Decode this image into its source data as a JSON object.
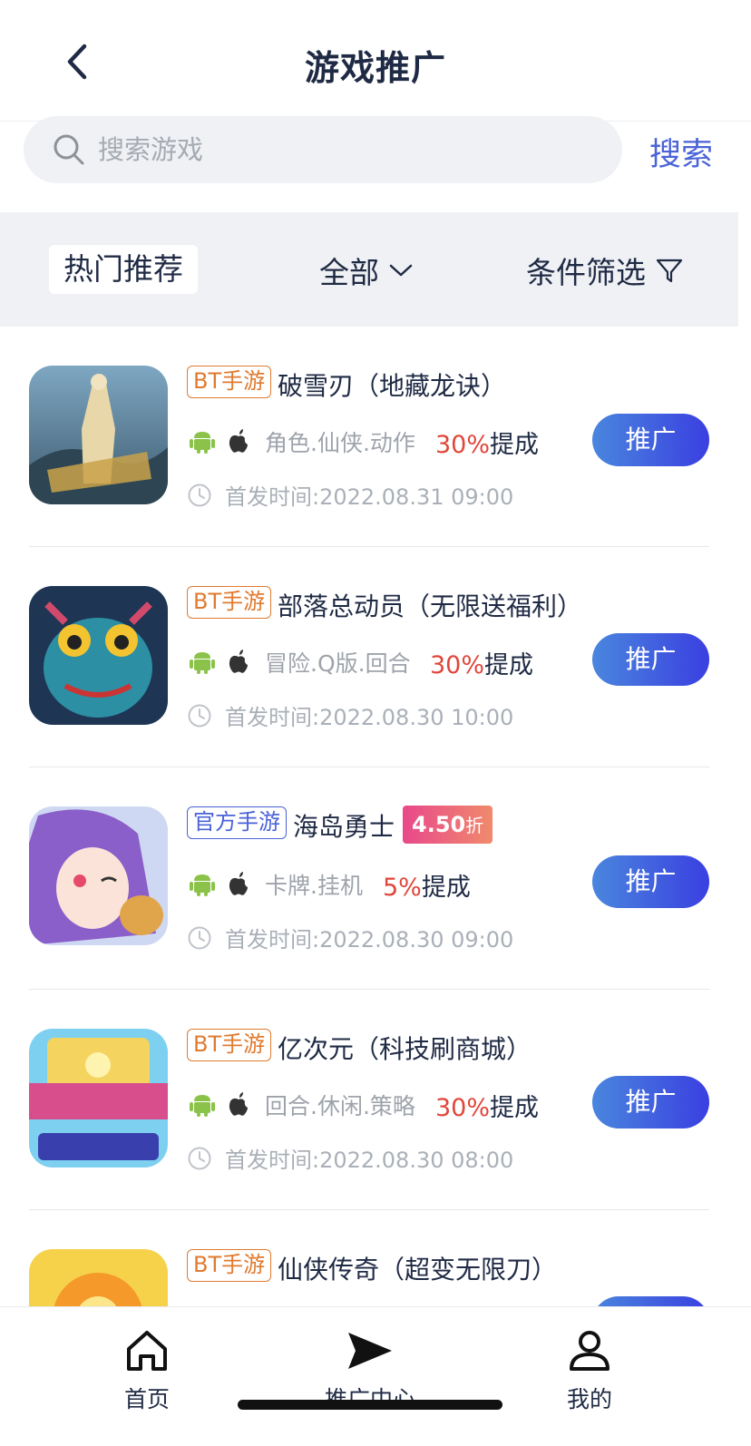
{
  "header": {
    "title": "游戏推广"
  },
  "search": {
    "placeholder": "搜索游戏",
    "button_label": "搜索"
  },
  "filters": {
    "hot": "热门推荐",
    "all": "全部",
    "condition": "条件筛选"
  },
  "games": [
    {
      "tag": "BT手游",
      "name": "破雪刃（地藏龙诀）",
      "genre": "角色.仙侠.动作",
      "rate": "30%",
      "rate_suffix": "提成",
      "release": "首发时间:2022.08.31 09:00",
      "button": "推广"
    },
    {
      "tag": "BT手游",
      "name": "部落总动员（无限送福利）",
      "genre": "冒险.Q版.回合",
      "rate": "30%",
      "rate_suffix": "提成",
      "release": "首发时间:2022.08.30 10:00",
      "button": "推广"
    },
    {
      "tag": "官方手游",
      "name": "海岛勇士",
      "discount": "4.50",
      "discount_suffix": "折",
      "genre": "卡牌.挂机",
      "rate": "5%",
      "rate_suffix": "提成",
      "release": "首发时间:2022.08.30 09:00",
      "button": "推广"
    },
    {
      "tag": "BT手游",
      "name": "亿次元（科技刷商城）",
      "genre": "回合.休闲.策略",
      "rate": "30%",
      "rate_suffix": "提成",
      "release": "首发时间:2022.08.30 08:00",
      "button": "推广"
    },
    {
      "tag": "BT手游",
      "name": "仙侠传奇（超变无限刀）"
    }
  ],
  "nav": {
    "home": "首页",
    "promo": "推广中心",
    "mine": "我的"
  },
  "colors": {
    "accent": "#4a63d8",
    "rate": "#e0463b",
    "tag_bt": "#e07a2f",
    "button_start": "#4a86de",
    "button_end": "#3a3fe0"
  },
  "icons": [
    "back-arrow-icon",
    "search-icon",
    "chevron-down-icon",
    "filter-icon",
    "android-icon",
    "apple-icon",
    "clock-icon",
    "home-icon",
    "send-icon",
    "user-icon"
  ]
}
